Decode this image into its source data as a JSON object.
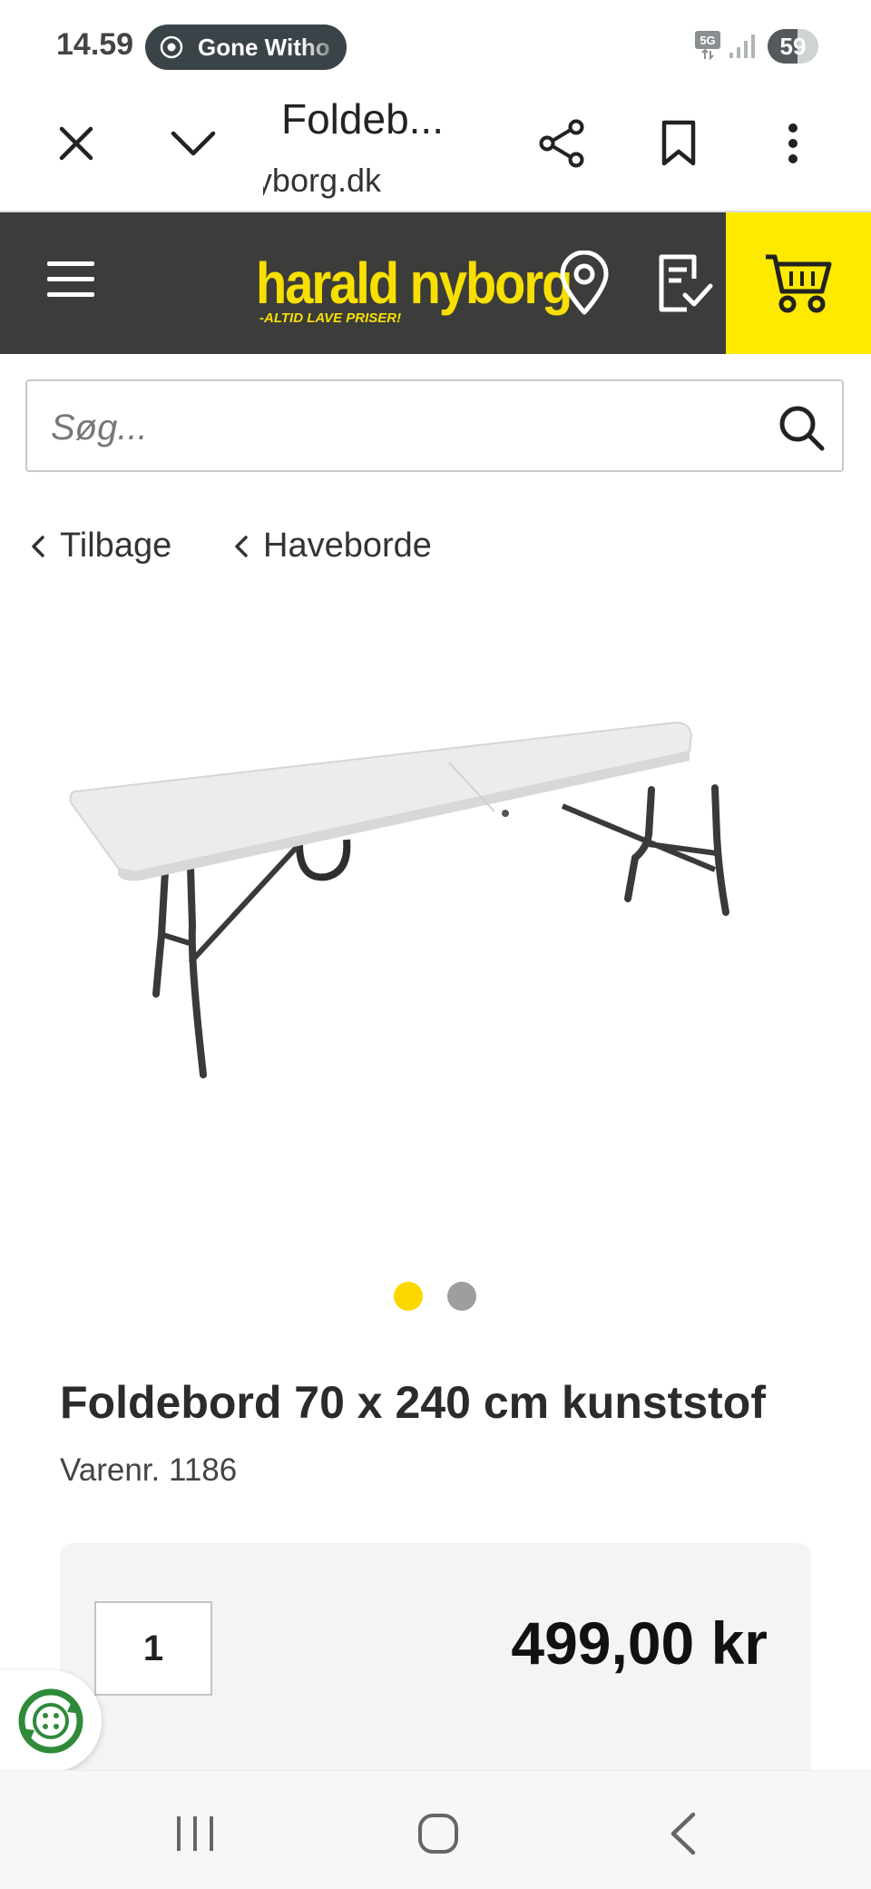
{
  "status_bar": {
    "time": "14.59",
    "media_title": "Gone Witho",
    "network": "5G",
    "battery": "59",
    "battery_fraction": 0.59
  },
  "browser": {
    "page_title": "Foldeb...",
    "domain": "haraldnyborg.dk",
    "icons": [
      "close-icon",
      "chevron-down-icon",
      "share-icon",
      "bookmark-icon",
      "more-vert-icon"
    ]
  },
  "site_header": {
    "logo_text": "harald nyborg",
    "logo_tagline": "-ALTID LAVE PRISER!",
    "icons": [
      "menu-icon",
      "location-pin-icon",
      "checklist-icon",
      "cart-icon"
    ],
    "brand_yellow": "#fdea00",
    "header_bg": "#3c3c3b"
  },
  "search": {
    "placeholder": "Søg...",
    "value": ""
  },
  "breadcrumbs": {
    "back_label": "Tilbage",
    "category_label": "Haveborde"
  },
  "carousel": {
    "image_count": 2,
    "active_index": 0,
    "active_color": "#fdd800",
    "inactive_color": "#9e9e9e"
  },
  "product": {
    "title": "Foldebord 70 x 240 cm kunststof",
    "sku": "Varenr. 1186",
    "quantity": "1",
    "price": "499,00 kr"
  },
  "nav_bar": {
    "icons": [
      "recent-apps-icon",
      "home-icon",
      "back-icon"
    ]
  }
}
